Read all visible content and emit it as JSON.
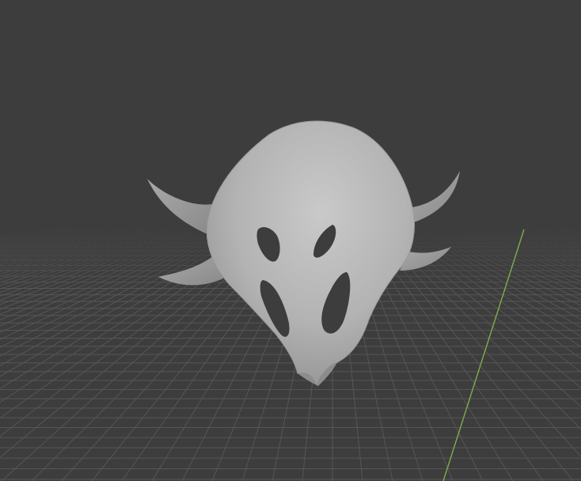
{
  "viewport": {
    "background_color": "#3d3d3d",
    "grid_color": "#555555",
    "axis_y_color": "#7bb04a",
    "object": {
      "name": "mask",
      "color": "#b4b4b4"
    }
  }
}
